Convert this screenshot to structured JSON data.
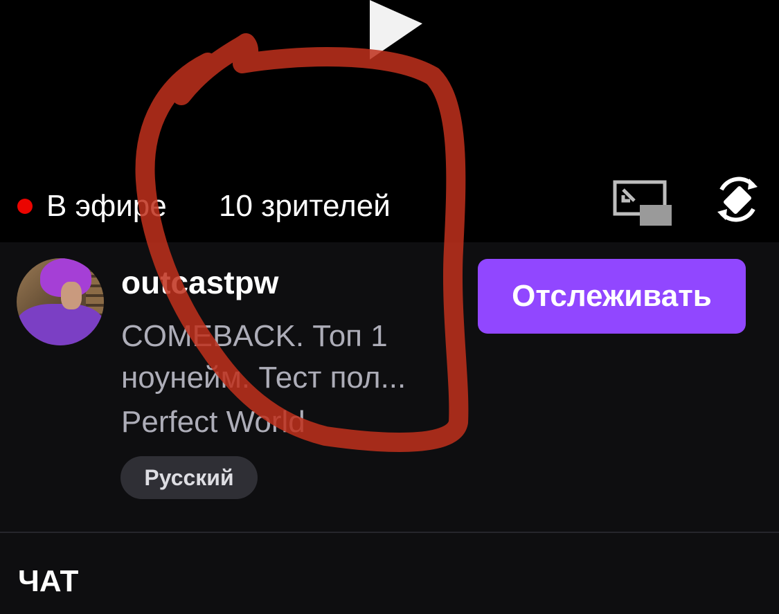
{
  "player": {
    "play_icon": "play-icon",
    "live_label": "В эфире",
    "viewers": "10 зрителей",
    "pip_icon": "picture-in-picture-icon",
    "rotate_icon": "rotate-screen-icon",
    "live_color": "#eb0400"
  },
  "channel": {
    "username": "outcastpw",
    "title": "COMEBACK. Топ 1 ноунейм. Тест пол...",
    "category": "Perfect World",
    "tag": "Русский",
    "follow_label": "Отслеживать",
    "accent_color": "#9147ff"
  },
  "chat": {
    "label": "ЧАТ"
  }
}
